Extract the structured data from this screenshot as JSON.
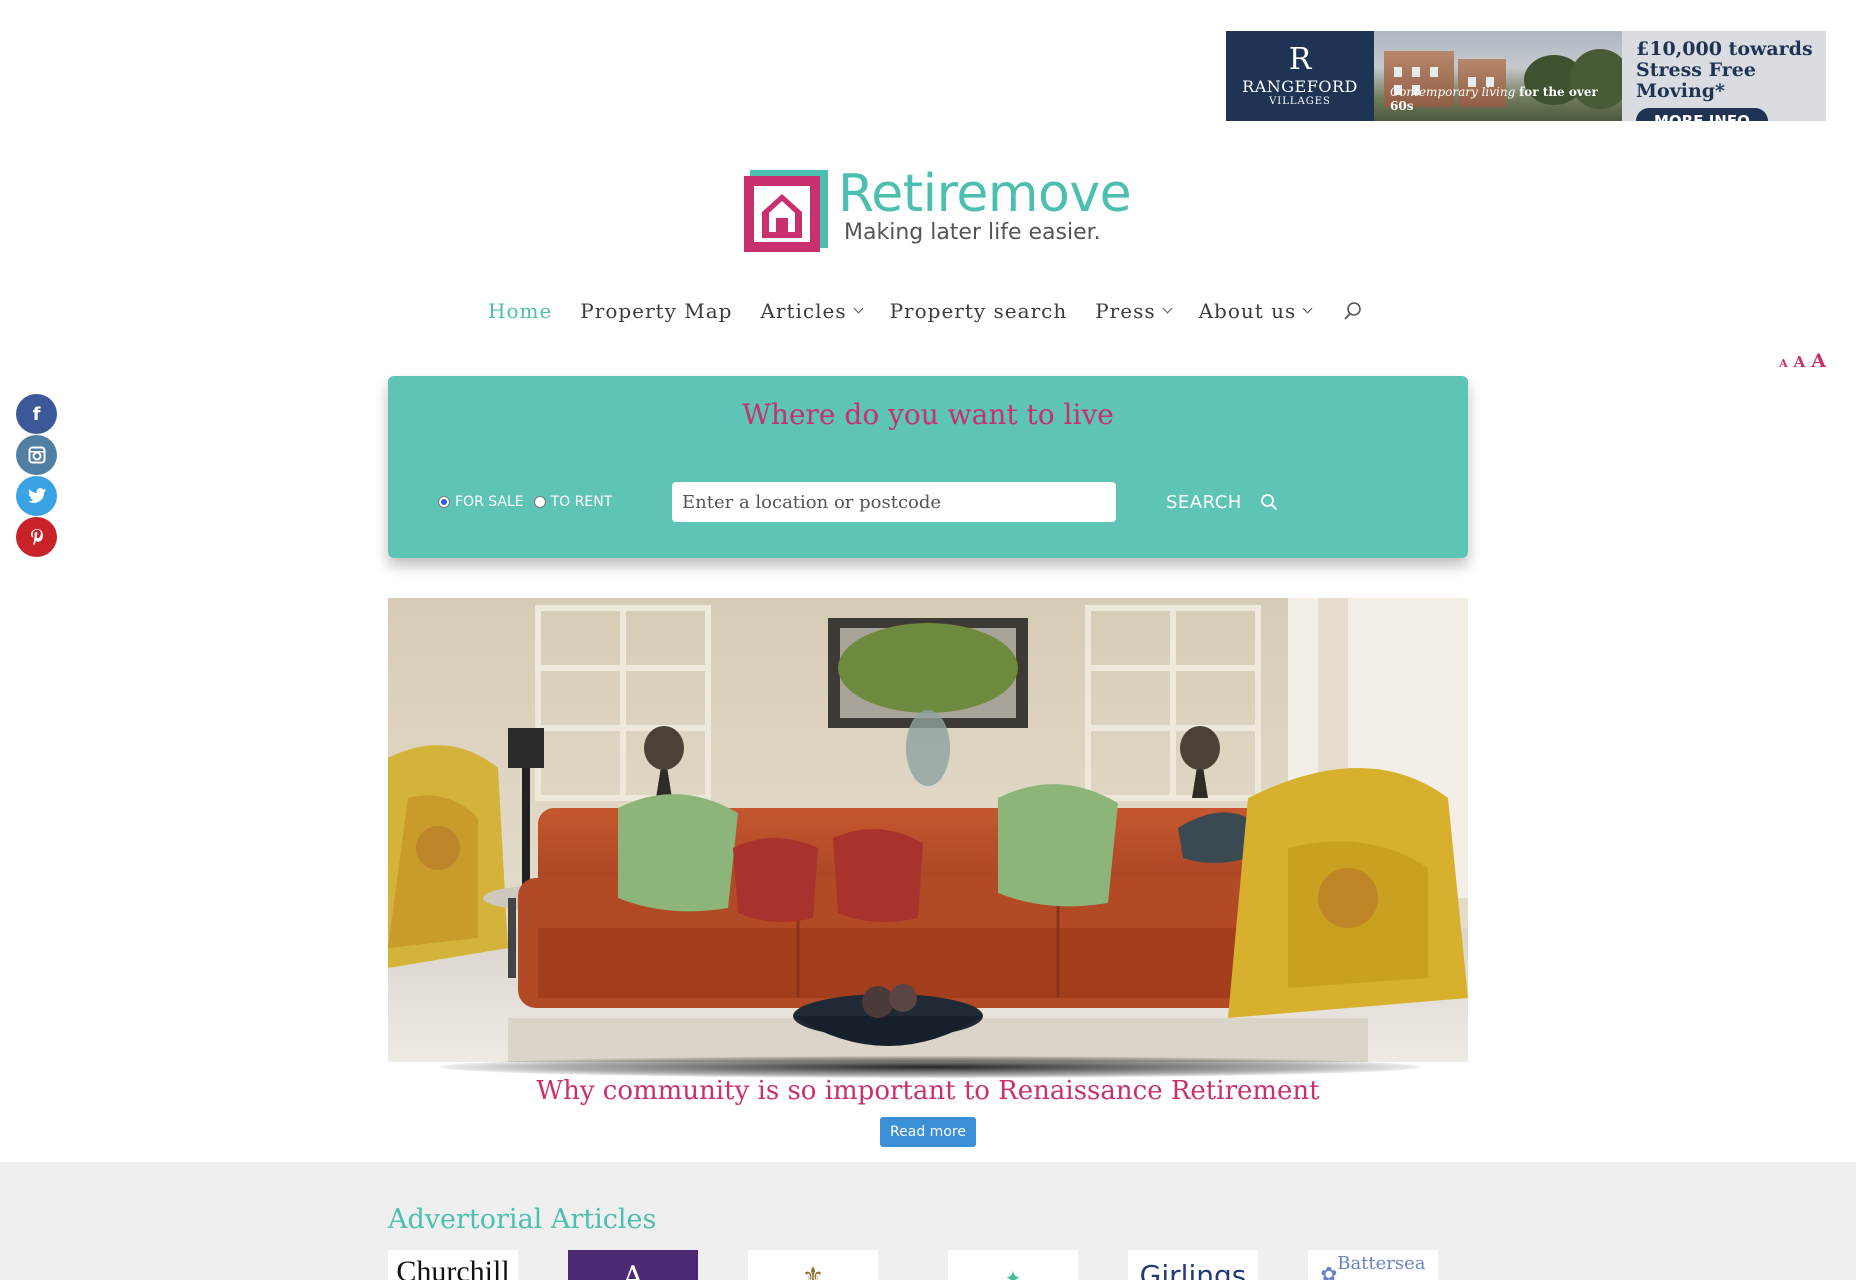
{
  "ad": {
    "brand_letter": "R",
    "brand_name": "RANGEFORD",
    "brand_sub": "VILLAGES",
    "caption_italic": "Contemporary living",
    "caption_bold": "for the over 60s",
    "headline_line1": "£10,000 towards",
    "headline_line2": "Stress Free Moving*",
    "button": "MORE INFO"
  },
  "logo": {
    "title": "Retiremove",
    "tagline": "Making later life easier."
  },
  "nav": {
    "items": [
      {
        "label": "Home",
        "active": true,
        "dropdown": false
      },
      {
        "label": "Property Map",
        "active": false,
        "dropdown": false
      },
      {
        "label": "Articles",
        "active": false,
        "dropdown": true
      },
      {
        "label": "Property search",
        "active": false,
        "dropdown": false
      },
      {
        "label": "Press",
        "active": false,
        "dropdown": true
      },
      {
        "label": "About us",
        "active": false,
        "dropdown": true
      }
    ],
    "search_icon": "search-icon"
  },
  "font_size": {
    "small": "A",
    "medium": "A",
    "large": "A"
  },
  "social": [
    {
      "name": "facebook",
      "glyph": "f",
      "color": "#3b5998"
    },
    {
      "name": "instagram",
      "glyph": "◙",
      "color": "#517fa4"
    },
    {
      "name": "twitter",
      "glyph": "✦",
      "color": "#3aa3e3"
    },
    {
      "name": "pinterest",
      "glyph": "P",
      "color": "#c92228"
    }
  ],
  "search": {
    "title": "Where do you want to live",
    "options": [
      {
        "label": "FOR SALE",
        "selected": true
      },
      {
        "label": "TO RENT",
        "selected": false
      }
    ],
    "placeholder": "Enter a location or postcode",
    "button": "SEARCH"
  },
  "hero": {
    "title": "Why community is so important to Renaissance Retirement",
    "button": "Read more"
  },
  "advertorial": {
    "title": "Advertorial Articles",
    "partners": [
      "Churchill",
      "A",
      "",
      "",
      "Girlings",
      "Battersea"
    ]
  },
  "colors": {
    "accent_teal": "#5ec4b6",
    "brand_pink": "#c8306e",
    "link_blue": "#3b8fd6"
  }
}
